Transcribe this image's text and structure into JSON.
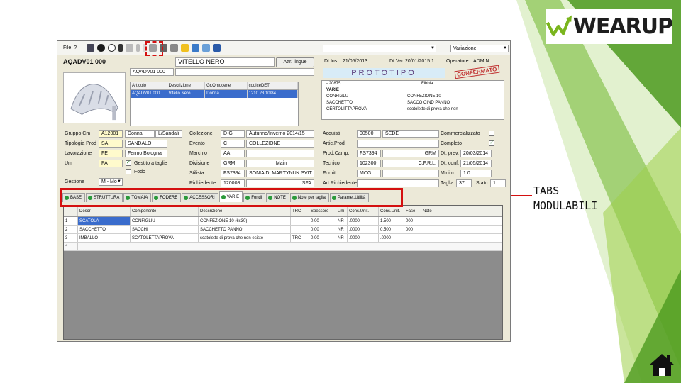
{
  "colors": {
    "accent_red": "#d41010",
    "green_dark": "#4c9a1e",
    "green_light": "#9fd04a",
    "selection_blue": "#3a6ccc",
    "banner_bg": "#d8ecf7"
  },
  "logo": {
    "text": "WEARUP"
  },
  "callout": {
    "text": "TABS\nMODULABILI"
  },
  "home_icon": "home-icon",
  "app": {
    "menu": {
      "file": "File",
      "help": "?"
    },
    "toolbar_icons": [
      "print-icon",
      "save-icon",
      "check-icon",
      "open-icon",
      "undo-icon",
      "copy-icon",
      "paste-icon",
      "modular-icon",
      "doc-icon",
      "printer-icon",
      "folder-icon",
      "mail-icon",
      "settings-icon",
      "preview-icon"
    ],
    "variation_select": "Variazione",
    "header": {
      "code": "AQADV01 000",
      "description": "VITELLO NERO",
      "sub_code": "AQADV01 000",
      "button_label": "Attr. lingue",
      "dt_ins_label": "Dt.Ins.",
      "dt_ins": "21/05/2013",
      "dt_var_label": "Dt.Var.",
      "dt_var": "20/01/2015 1",
      "operator_label": "Operatore",
      "operator": "ADMIN",
      "banner": "PROTOTIPO",
      "stamp": "CONFERMATO"
    },
    "articles_grid": {
      "columns": [
        "Articolo",
        "Descrizione",
        "Gr.Omocene",
        "codiceDET"
      ],
      "rows": [
        [
          "AQADV01 000",
          "Vitello Nero",
          "Donna",
          "1210 23 10/84"
        ]
      ]
    },
    "tree": [
      "- 20875",
      "VARIE",
      "  CONFIGLU",
      "  SACCHETTO",
      "  CERTOLITTAPROVA",
      "Fibbia",
      "CONFEZIONE 10",
      "SACCO CIND PANNO",
      "scotolette di prova che non"
    ],
    "form": {
      "left": [
        {
          "label": "Gruppo Cm",
          "value": "A12001",
          "extra": "Donna",
          "extra2": "L/Sandali"
        },
        {
          "label": "Tipologia Prod",
          "value": "SA",
          "extra": "SANDALO"
        },
        {
          "label": "Lavorazione",
          "value": "FE",
          "extra": "Fermo Bologna"
        },
        {
          "label": "Um",
          "value": "PA",
          "extra": "Gestito a taglie"
        },
        {
          "label": "Gestione",
          "value": "M - Mo"
        }
      ],
      "checks": [
        {
          "label": "Gestito a taglie",
          "checked": true
        },
        {
          "label": "Fodo",
          "checked": false
        }
      ],
      "middle": [
        {
          "label": "Collezione",
          "value": "D-G",
          "extra": "Autunno/Inverno 2014/15"
        },
        {
          "label": "Evento",
          "value": "C",
          "extra": "COLLEZIONE"
        },
        {
          "label": "Marchio",
          "value": "AA",
          "extra": ""
        },
        {
          "label": "Divisione",
          "value": "GRM",
          "extra": "Main"
        },
        {
          "label": "Stilista",
          "value": "FS7394",
          "extra": "SONIA DI MARTYNUK SVIT"
        },
        {
          "label": "Richiedente",
          "value": "120008",
          "extra": "SFA"
        }
      ],
      "right": [
        {
          "label": "Acquisti",
          "value": "00500",
          "extra": "SEDE"
        },
        {
          "label": "Artic.Prod",
          "value": "",
          "extra": ""
        },
        {
          "label": "Prod.Camp.",
          "value": "FS7394",
          "extra": "GRM"
        },
        {
          "label": "Tecnico",
          "value": "102300",
          "extra": "C.F.R.L."
        },
        {
          "label": "Fornit.",
          "value": "MCG",
          "extra": ""
        },
        {
          "label": "Art.Richiedente",
          "value": "",
          "extra": ""
        }
      ],
      "far_right": [
        {
          "label": "Commercializzato",
          "value": ""
        },
        {
          "label": "Completo",
          "value": "✓"
        },
        {
          "label": "Dt. prev.",
          "value": "20/03/2014"
        },
        {
          "label": "Dt. conf.",
          "value": "21/05/2014"
        },
        {
          "label": "Minim.",
          "value": "1.0"
        },
        {
          "label": "Taglia",
          "value": "37",
          "extra_label": "Stato",
          "extra": "1"
        }
      ]
    },
    "tabs": [
      {
        "label": "BASE",
        "active": false
      },
      {
        "label": "STRUTTURA",
        "active": false
      },
      {
        "label": "TOMAIA",
        "active": false
      },
      {
        "label": "FODERE",
        "active": false
      },
      {
        "label": "ACCESSORI",
        "active": false
      },
      {
        "label": "VARIE",
        "active": true
      },
      {
        "label": "Fondi",
        "active": false
      },
      {
        "label": "NOTE",
        "active": false
      },
      {
        "label": "Note per taglia",
        "active": false
      },
      {
        "label": "Paramet.Utilità",
        "active": false
      }
    ],
    "grid": {
      "columns": [
        "",
        "Descr",
        "Componente",
        "Descrizione",
        "TRC",
        "Spessore",
        "Um",
        "Cons.Unit.",
        "Cons.Unit.",
        "Fase",
        "Note"
      ],
      "rows": [
        [
          "1",
          "SCATOLA",
          "CONFIGLIU",
          "CONFEZIONE 10 (6x30)",
          "",
          "0.00",
          "NR",
          ".0000",
          "1.500",
          "000",
          ""
        ],
        [
          "2",
          "SACCHETTO",
          "SACCHI",
          "SACCHETTO PANNO",
          "",
          "0.00",
          "NR",
          ".0000",
          "0.500",
          "000",
          ""
        ],
        [
          "3",
          "IMBALLO",
          "SCATOLETTAPROVA",
          "scatolette di prova che non esiste",
          "TRC",
          "0.00",
          "NR",
          ".0000",
          ".0000",
          "",
          ""
        ]
      ],
      "new_row_marker": "*"
    }
  }
}
